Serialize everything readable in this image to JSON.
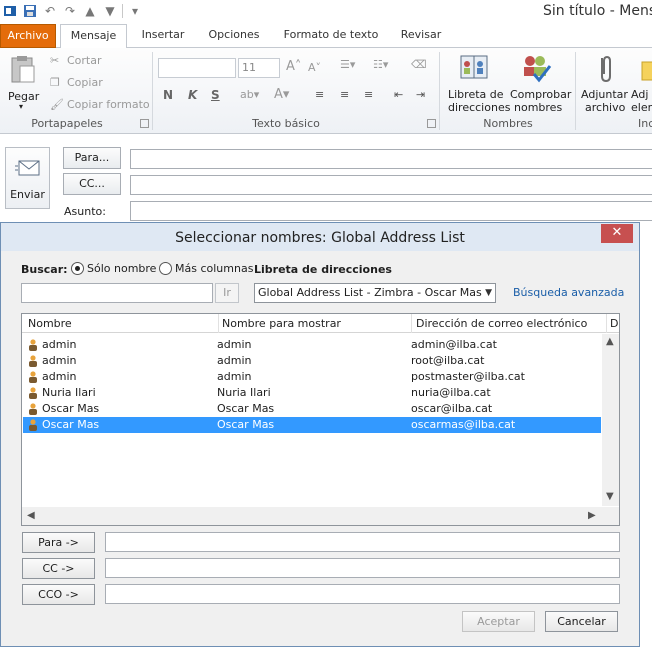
{
  "window": {
    "title": "Sin título - Mens"
  },
  "qat": {
    "icons": [
      "outlook-icon",
      "save-icon",
      "undo-icon",
      "redo-icon",
      "up-arrow-icon",
      "down-arrow-icon",
      "customize-icon"
    ]
  },
  "tabs": [
    {
      "label": "Archivo"
    },
    {
      "label": "Mensaje"
    },
    {
      "label": "Insertar"
    },
    {
      "label": "Opciones"
    },
    {
      "label": "Formato de texto"
    },
    {
      "label": "Revisar"
    }
  ],
  "ribbon": {
    "clipboard": {
      "paste": "Pegar",
      "cut": "Cortar",
      "copy": "Copiar",
      "format_painter": "Copiar formato",
      "label": "Portapapeles"
    },
    "basic_text": {
      "font_size": "11",
      "label": "Texto básico",
      "bold": "N",
      "italic": "K",
      "underline": "S"
    },
    "names": {
      "address_book_line1": "Libreta de",
      "address_book_line2": "direcciones",
      "check_names_line1": "Comprobar",
      "check_names_line2": "nombres",
      "label": "Nombres"
    },
    "include": {
      "attach_line1": "Adjuntar",
      "attach_line2": "archivo",
      "attach_item_line1": "Adj",
      "attach_item_line2": "elem",
      "label": "Inc"
    }
  },
  "compose": {
    "send": "Enviar",
    "to": "Para...",
    "cc": "CC...",
    "subject": "Asunto:"
  },
  "dialog": {
    "title": "Seleccionar nombres: Global Address List",
    "close": "✕",
    "search_label": "Buscar:",
    "radio_name_only": "Sólo nombre",
    "radio_more_columns": "Más columnas",
    "address_book_label": "Libreta de direcciones",
    "search_value": "",
    "go_button": "Ir",
    "address_book_selected": "Global Address List - Zimbra - Oscar Mas",
    "advanced_search": "Búsqueda avanzada",
    "columns": [
      "Nombre",
      "Nombre para mostrar",
      "Dirección de correo electrónico",
      "D"
    ],
    "rows": [
      {
        "name": "admin",
        "display": "admin",
        "email": "admin@ilba.cat",
        "selected": false
      },
      {
        "name": "admin",
        "display": "admin",
        "email": "root@ilba.cat",
        "selected": false
      },
      {
        "name": "admin",
        "display": "admin",
        "email": "postmaster@ilba.cat",
        "selected": false
      },
      {
        "name": "Nuria Ilari",
        "display": "Nuria Ilari",
        "email": "nuria@ilba.cat",
        "selected": false
      },
      {
        "name": "Oscar Mas",
        "display": "Oscar Mas",
        "email": "oscar@ilba.cat",
        "selected": false
      },
      {
        "name": "Oscar Mas",
        "display": "Oscar Mas",
        "email": "oscarmas@ilba.cat",
        "selected": true
      }
    ],
    "to_button": "Para ->",
    "cc_button": "CC ->",
    "bcc_button": "CCO ->",
    "accept": "Aceptar",
    "cancel": "Cancelar"
  },
  "colors": {
    "file_tab": "#e46c0a",
    "selection": "#3399ff",
    "link": "#1a5ea8",
    "close": "#c75050"
  }
}
